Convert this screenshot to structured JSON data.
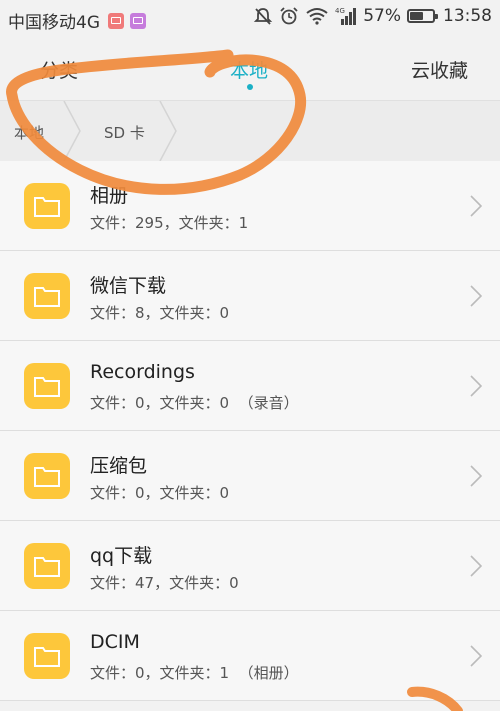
{
  "status": {
    "carrier": "中国移动4G",
    "battery": "57%",
    "battery_level": 0.57,
    "time": "13:58",
    "signal_tag": "4G"
  },
  "tabs": [
    {
      "label": "分类"
    },
    {
      "label": "本地"
    },
    {
      "label": "云收藏"
    }
  ],
  "breadcrumb": [
    {
      "label": "本地"
    },
    {
      "label": "SD 卡"
    }
  ],
  "folders": [
    {
      "name": "相册",
      "info": "文件：295，文件夹：1"
    },
    {
      "name": "微信下载",
      "info": "文件：8，文件夹：0"
    },
    {
      "name": "Recordings",
      "info": "文件：0，文件夹：0  （录音）"
    },
    {
      "name": "压缩包",
      "info": "文件：0，文件夹：0"
    },
    {
      "name": "qq下载",
      "info": "文件：47，文件夹：0"
    },
    {
      "name": "DCIM",
      "info": "文件：0，文件夹：1  （相册）"
    }
  ],
  "colors": {
    "accent": "#1bb0c6",
    "folder": "#fdc73b",
    "annotation": "#f08a3c"
  }
}
